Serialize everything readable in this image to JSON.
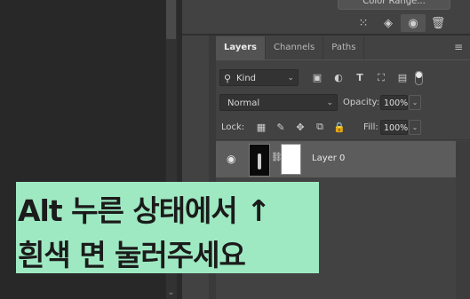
{
  "top_panel": {
    "color_range_label": "Color Range..."
  },
  "layers_panel": {
    "tabs": [
      {
        "label": "Layers",
        "active": true
      },
      {
        "label": "Channels",
        "active": false
      },
      {
        "label": "Paths",
        "active": false
      }
    ],
    "filter_kind": "Kind",
    "blend_mode": "Normal",
    "opacity_label": "Opacity:",
    "opacity_value": "100%",
    "lock_label": "Lock:",
    "fill_label": "Fill:",
    "fill_value": "100%",
    "layers": [
      {
        "name": "Layer 0",
        "visible": true,
        "selected": true
      }
    ]
  },
  "caption": {
    "line1": "Alt 누른 상태에서 ↑",
    "line2": "흰색 면 눌러주세요",
    "background_color": "#9ee9c2"
  }
}
